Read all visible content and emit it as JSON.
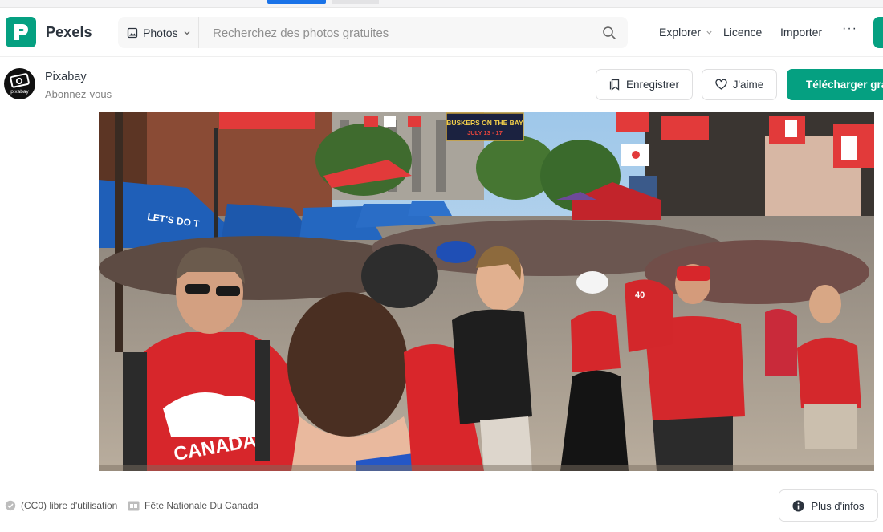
{
  "brand": {
    "name": "Pexels",
    "accent": "#05a081"
  },
  "search": {
    "type_label": "Photos",
    "placeholder": "Recherchez des photos gratuites"
  },
  "nav": {
    "explore": "Explorer",
    "license": "Licence",
    "upload": "Importer",
    "more": "···"
  },
  "author": {
    "name": "Pixabay",
    "follow": "Abonnez-vous",
    "avatar_text": "pixabay"
  },
  "actions": {
    "save": "Enregistrer",
    "like": "J'aime",
    "download": "Télécharger gratuitement"
  },
  "photo": {
    "banner_line1": "BUSKERS ON THE BAY",
    "banner_line2": "JULY 13 - 17",
    "umbrella_text": "LET'S DO T",
    "shirt_text": "CANADA",
    "shirt_number": "40"
  },
  "footer": {
    "license": "(CC0) libre d'utilisation",
    "tag": "Fête Nationale Du Canada",
    "more_info": "Plus d'infos"
  }
}
